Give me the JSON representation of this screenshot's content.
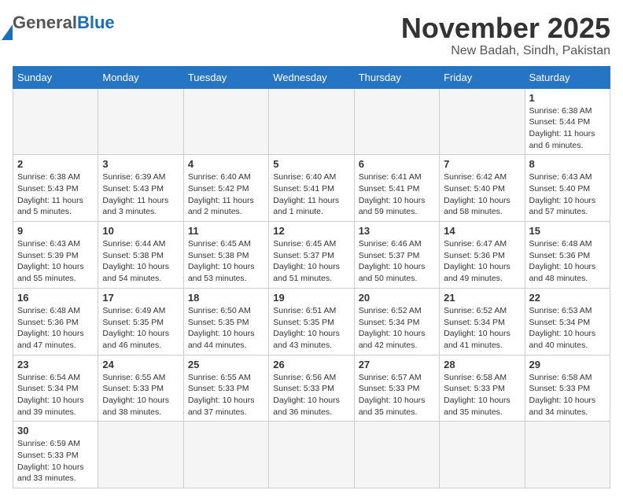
{
  "header": {
    "logo_general": "General",
    "logo_blue": "Blue",
    "month_title": "November 2025",
    "location": "New Badah, Sindh, Pakistan"
  },
  "weekdays": [
    "Sunday",
    "Monday",
    "Tuesday",
    "Wednesday",
    "Thursday",
    "Friday",
    "Saturday"
  ],
  "weeks": [
    [
      {
        "day": "",
        "info": ""
      },
      {
        "day": "",
        "info": ""
      },
      {
        "day": "",
        "info": ""
      },
      {
        "day": "",
        "info": ""
      },
      {
        "day": "",
        "info": ""
      },
      {
        "day": "",
        "info": ""
      },
      {
        "day": "1",
        "info": "Sunrise: 6:38 AM\nSunset: 5:44 PM\nDaylight: 11 hours\nand 6 minutes."
      }
    ],
    [
      {
        "day": "2",
        "info": "Sunrise: 6:38 AM\nSunset: 5:43 PM\nDaylight: 11 hours\nand 5 minutes."
      },
      {
        "day": "3",
        "info": "Sunrise: 6:39 AM\nSunset: 5:43 PM\nDaylight: 11 hours\nand 3 minutes."
      },
      {
        "day": "4",
        "info": "Sunrise: 6:40 AM\nSunset: 5:42 PM\nDaylight: 11 hours\nand 2 minutes."
      },
      {
        "day": "5",
        "info": "Sunrise: 6:40 AM\nSunset: 5:41 PM\nDaylight: 11 hours\nand 1 minute."
      },
      {
        "day": "6",
        "info": "Sunrise: 6:41 AM\nSunset: 5:41 PM\nDaylight: 10 hours\nand 59 minutes."
      },
      {
        "day": "7",
        "info": "Sunrise: 6:42 AM\nSunset: 5:40 PM\nDaylight: 10 hours\nand 58 minutes."
      },
      {
        "day": "8",
        "info": "Sunrise: 6:43 AM\nSunset: 5:40 PM\nDaylight: 10 hours\nand 57 minutes."
      }
    ],
    [
      {
        "day": "9",
        "info": "Sunrise: 6:43 AM\nSunset: 5:39 PM\nDaylight: 10 hours\nand 55 minutes."
      },
      {
        "day": "10",
        "info": "Sunrise: 6:44 AM\nSunset: 5:38 PM\nDaylight: 10 hours\nand 54 minutes."
      },
      {
        "day": "11",
        "info": "Sunrise: 6:45 AM\nSunset: 5:38 PM\nDaylight: 10 hours\nand 53 minutes."
      },
      {
        "day": "12",
        "info": "Sunrise: 6:45 AM\nSunset: 5:37 PM\nDaylight: 10 hours\nand 51 minutes."
      },
      {
        "day": "13",
        "info": "Sunrise: 6:46 AM\nSunset: 5:37 PM\nDaylight: 10 hours\nand 50 minutes."
      },
      {
        "day": "14",
        "info": "Sunrise: 6:47 AM\nSunset: 5:36 PM\nDaylight: 10 hours\nand 49 minutes."
      },
      {
        "day": "15",
        "info": "Sunrise: 6:48 AM\nSunset: 5:36 PM\nDaylight: 10 hours\nand 48 minutes."
      }
    ],
    [
      {
        "day": "16",
        "info": "Sunrise: 6:48 AM\nSunset: 5:36 PM\nDaylight: 10 hours\nand 47 minutes."
      },
      {
        "day": "17",
        "info": "Sunrise: 6:49 AM\nSunset: 5:35 PM\nDaylight: 10 hours\nand 46 minutes."
      },
      {
        "day": "18",
        "info": "Sunrise: 6:50 AM\nSunset: 5:35 PM\nDaylight: 10 hours\nand 44 minutes."
      },
      {
        "day": "19",
        "info": "Sunrise: 6:51 AM\nSunset: 5:35 PM\nDaylight: 10 hours\nand 43 minutes."
      },
      {
        "day": "20",
        "info": "Sunrise: 6:52 AM\nSunset: 5:34 PM\nDaylight: 10 hours\nand 42 minutes."
      },
      {
        "day": "21",
        "info": "Sunrise: 6:52 AM\nSunset: 5:34 PM\nDaylight: 10 hours\nand 41 minutes."
      },
      {
        "day": "22",
        "info": "Sunrise: 6:53 AM\nSunset: 5:34 PM\nDaylight: 10 hours\nand 40 minutes."
      }
    ],
    [
      {
        "day": "23",
        "info": "Sunrise: 6:54 AM\nSunset: 5:34 PM\nDaylight: 10 hours\nand 39 minutes."
      },
      {
        "day": "24",
        "info": "Sunrise: 6:55 AM\nSunset: 5:33 PM\nDaylight: 10 hours\nand 38 minutes."
      },
      {
        "day": "25",
        "info": "Sunrise: 6:55 AM\nSunset: 5:33 PM\nDaylight: 10 hours\nand 37 minutes."
      },
      {
        "day": "26",
        "info": "Sunrise: 6:56 AM\nSunset: 5:33 PM\nDaylight: 10 hours\nand 36 minutes."
      },
      {
        "day": "27",
        "info": "Sunrise: 6:57 AM\nSunset: 5:33 PM\nDaylight: 10 hours\nand 35 minutes."
      },
      {
        "day": "28",
        "info": "Sunrise: 6:58 AM\nSunset: 5:33 PM\nDaylight: 10 hours\nand 35 minutes."
      },
      {
        "day": "29",
        "info": "Sunrise: 6:58 AM\nSunset: 5:33 PM\nDaylight: 10 hours\nand 34 minutes."
      }
    ],
    [
      {
        "day": "30",
        "info": "Sunrise: 6:59 AM\nSunset: 5:33 PM\nDaylight: 10 hours\nand 33 minutes."
      },
      {
        "day": "",
        "info": ""
      },
      {
        "day": "",
        "info": ""
      },
      {
        "day": "",
        "info": ""
      },
      {
        "day": "",
        "info": ""
      },
      {
        "day": "",
        "info": ""
      },
      {
        "day": "",
        "info": ""
      }
    ]
  ]
}
